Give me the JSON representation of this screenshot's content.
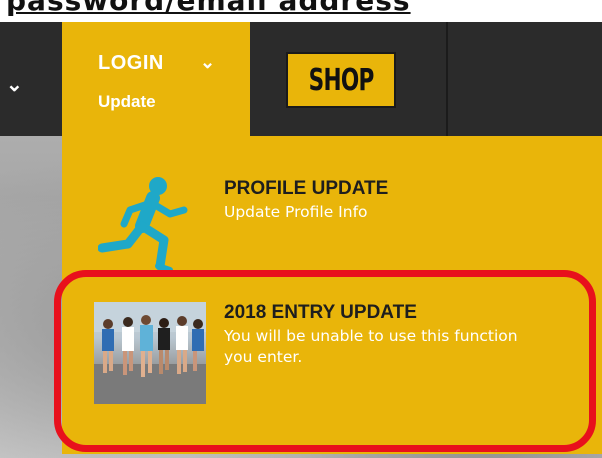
{
  "header_clip": {
    "text": "password/email address"
  },
  "nav": {
    "login_label": "LOGIN",
    "login_sub": "Update",
    "shop_label": "SHOP"
  },
  "dropdown": {
    "items": [
      {
        "title": "PROFILE UPDATE",
        "subtitle": "Update Profile Info",
        "icon": "runner-icon"
      },
      {
        "title": "2018 ENTRY UPDATE",
        "subtitle_line1": "You will be unable to use this function",
        "subtitle_line2": "you enter.",
        "icon": "race-photo"
      }
    ]
  },
  "colors": {
    "nav_bg": "#2b2b2b",
    "accent_yellow": "#e9b50a",
    "runner_blue": "#1fa8c8",
    "highlight_red": "#e8101c"
  }
}
